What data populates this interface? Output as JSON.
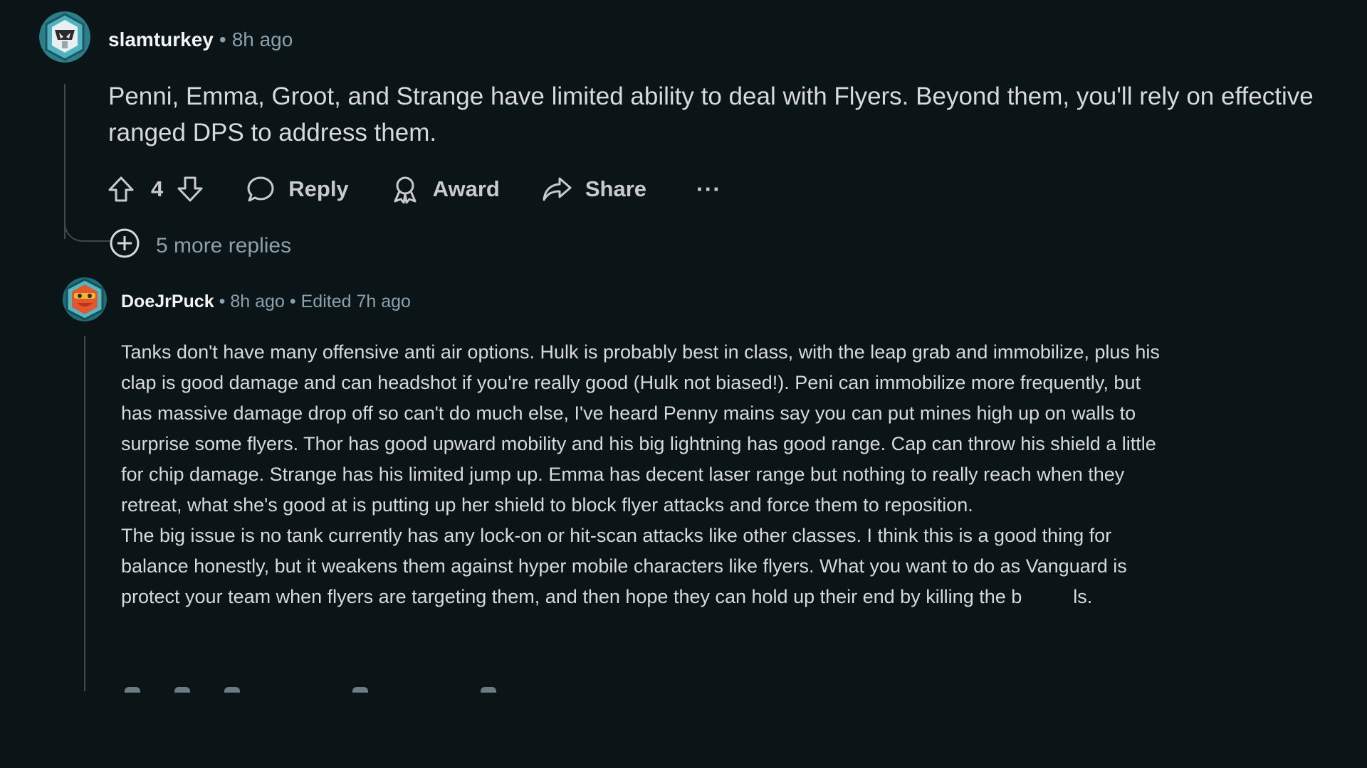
{
  "comment1": {
    "author": "slamturkey",
    "time": "8h ago",
    "body": "Penni, Emma, Groot, and Strange have limited ability to deal with Flyers. Beyond them, you'll rely on effective ranged DPS to address them.",
    "votes": "4",
    "reply_label": "Reply",
    "award_label": "Award",
    "share_label": "Share",
    "more_label": "···"
  },
  "more_replies": {
    "label": "5 more replies"
  },
  "comment2": {
    "author": "DoeJrPuck",
    "time": "8h ago",
    "edited": "Edited 7h ago",
    "paragraph1": "Tanks don't have many offensive anti air options. Hulk is probably best in class, with the leap grab and immobilize, plus his clap is good damage and can headshot if you're really good (Hulk not biased!). Peni can immobilize more frequently, but has massive damage drop off so can't do much else, I've heard Penny mains say you can put mines high up on walls to surprise some flyers. Thor has good upward mobility and his big lightning has good range. Cap can throw his shield a little for chip damage. Strange has his limited jump up. Emma has decent laser range but nothing to really reach when they retreat, what she's good at is putting up her shield to block flyer attacks and force them to reposition.",
    "paragraph2_main": "The big issue is no tank currently has any lock-on or hit-scan attacks like other classes. I think this is a good thing for balance honestly, but it weakens them against hyper mobile characters like flyers. What you want to do as Vanguard is protect your team when flyers are targeting them, and then hope they can hold up their end by killing the b",
    "paragraph2_end": "ls."
  },
  "colors": {
    "background": "#0b1416",
    "text": "#d7dadc",
    "muted": "#8ba2ad",
    "thread_line": "#3e4a4e"
  },
  "icons": {
    "avatar1": "snoo-avatar-helmet",
    "avatar2": "snoo-avatar-red-mask",
    "upvote": "arrow-up-icon",
    "downvote": "arrow-down-icon",
    "reply": "chat-bubble-icon",
    "award": "award-ribbon-icon",
    "share": "share-arrow-icon",
    "expand": "plus-circle-icon"
  }
}
